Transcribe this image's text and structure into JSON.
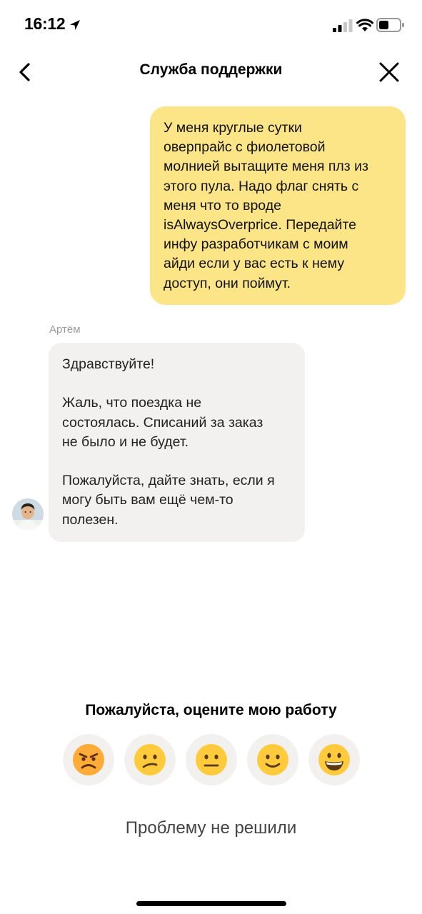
{
  "status_bar": {
    "time": "16:12"
  },
  "header": {
    "title": "Служба поддержки",
    "back_icon": "chevron-left-icon",
    "close_icon": "close-icon"
  },
  "messages": {
    "user": {
      "lines": [
        "У меня круглые сутки",
        "оверпрайс с фиолетовой",
        "молнией вытащите меня плз из",
        "этого пула. Надо флаг снять с",
        "меня что то вроде",
        "isAlwaysOverprice. Передайте",
        "инфу разработчикам с моим",
        "айди если у вас есть к нему",
        "доступ, они поймут."
      ]
    },
    "agent": {
      "name": "Артём",
      "paragraph_1": [
        "Здравствуйте!"
      ],
      "paragraph_2": [
        "Жаль, что поездка не",
        "состоялась. Списаний за заказ",
        "не было и не будет."
      ],
      "paragraph_3": [
        "Пожалуйста, дайте знать, если я",
        "могу быть вам ещё чем-то",
        "полезен."
      ]
    }
  },
  "rating": {
    "title": "Пожалуйста, оцените мою работу",
    "options": [
      "angry-face-icon",
      "confused-face-icon",
      "neutral-face-icon",
      "slightly-smiling-face-icon",
      "grinning-face-icon"
    ]
  },
  "footer": {
    "not_solved_label": "Проблему не решили"
  },
  "colors": {
    "user_bubble": "#fce586",
    "agent_bubble": "#f2f1ef",
    "emoji_yellow": "#ffcb3d"
  }
}
